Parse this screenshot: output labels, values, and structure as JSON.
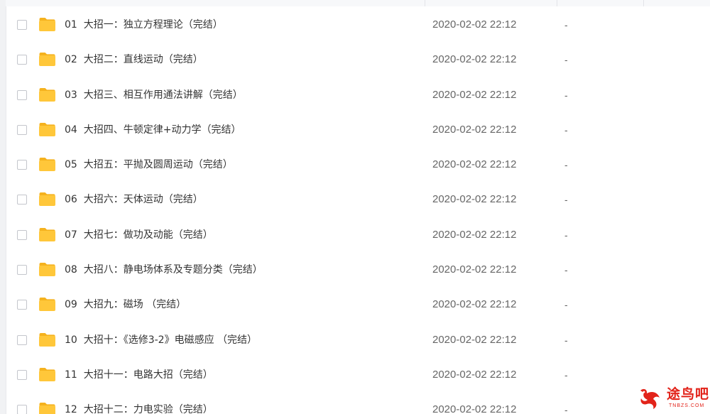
{
  "files": [
    {
      "name": "01  大招一：独立方程理论（完结）",
      "modified": "2020-02-02 22:12",
      "size": "-"
    },
    {
      "name": "02  大招二：直线运动（完结）",
      "modified": "2020-02-02 22:12",
      "size": "-"
    },
    {
      "name": "03  大招三、相互作用通法讲解（完结）",
      "modified": "2020-02-02 22:12",
      "size": "-"
    },
    {
      "name": "04  大招四、牛顿定律+动力学（完结）",
      "modified": "2020-02-02 22:12",
      "size": "-"
    },
    {
      "name": "05  大招五：平抛及圆周运动（完结）",
      "modified": "2020-02-02 22:12",
      "size": "-"
    },
    {
      "name": "06  大招六：天体运动（完结）",
      "modified": "2020-02-02 22:12",
      "size": "-"
    },
    {
      "name": "07  大招七：做功及动能（完结）",
      "modified": "2020-02-02 22:12",
      "size": "-"
    },
    {
      "name": "08  大招八：静电场体系及专题分类（完结）",
      "modified": "2020-02-02 22:12",
      "size": "-"
    },
    {
      "name": "09  大招九：磁场 （完结）",
      "modified": "2020-02-02 22:12",
      "size": "-"
    },
    {
      "name": "10  大招十：《选修3-2》电磁感应 （完结）",
      "modified": "2020-02-02 22:12",
      "size": "-"
    },
    {
      "name": "11  大招十一：电路大招（完结）",
      "modified": "2020-02-02 22:12",
      "size": "-"
    },
    {
      "name": "12  大招十二：力电实验（完结）",
      "modified": "2020-02-02 22:12",
      "size": "-"
    }
  ],
  "icons": {
    "row_icon": "folder-icon",
    "watermark_icon": "bird-logo-icon"
  },
  "colors": {
    "folder": "#ffc73a",
    "folder_tab": "#f5b21e",
    "checkbox_border": "#c4c6cc",
    "text": "#333333",
    "meta_text": "#666666",
    "watermark": "#e2231a"
  },
  "watermark": {
    "title": "途鸟吧",
    "subtitle": "TNBZS.COM"
  }
}
